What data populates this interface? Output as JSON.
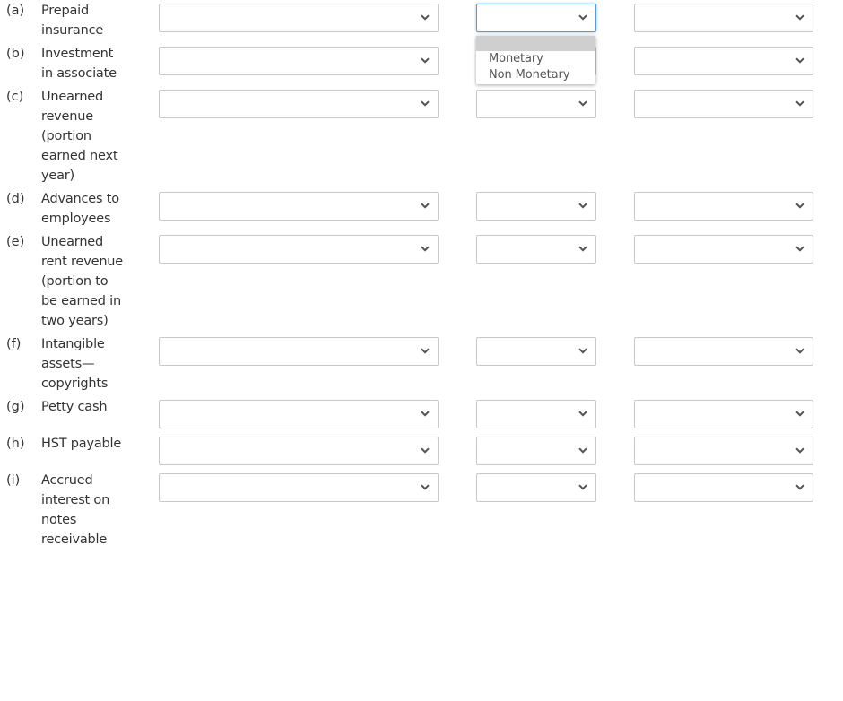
{
  "rows": [
    {
      "letter": "(a)",
      "label": "Prepaid insurance"
    },
    {
      "letter": "(b)",
      "label": "Investment in associate"
    },
    {
      "letter": "(c)",
      "label": "Unearned revenue (portion earned next year)"
    },
    {
      "letter": "(d)",
      "label": "Advances to employees"
    },
    {
      "letter": "(e)",
      "label": "Unearned rent revenue (portion to be earned in two years)"
    },
    {
      "letter": "(f)",
      "label": "Intangible assets— copyrights"
    },
    {
      "letter": "(g)",
      "label": "Petty cash"
    },
    {
      "letter": "(h)",
      "label": "HST payable"
    },
    {
      "letter": "(i)",
      "label": "Accrued interest on notes receivable"
    }
  ],
  "select_values": {
    "col1": "",
    "col2": "",
    "col3": ""
  },
  "open_dropdown": {
    "row": "(a)",
    "column": 2,
    "options": [
      "",
      "Monetary",
      "Non Monetary"
    ]
  },
  "icons": {
    "select_arrow": "chevron-down-icon"
  }
}
